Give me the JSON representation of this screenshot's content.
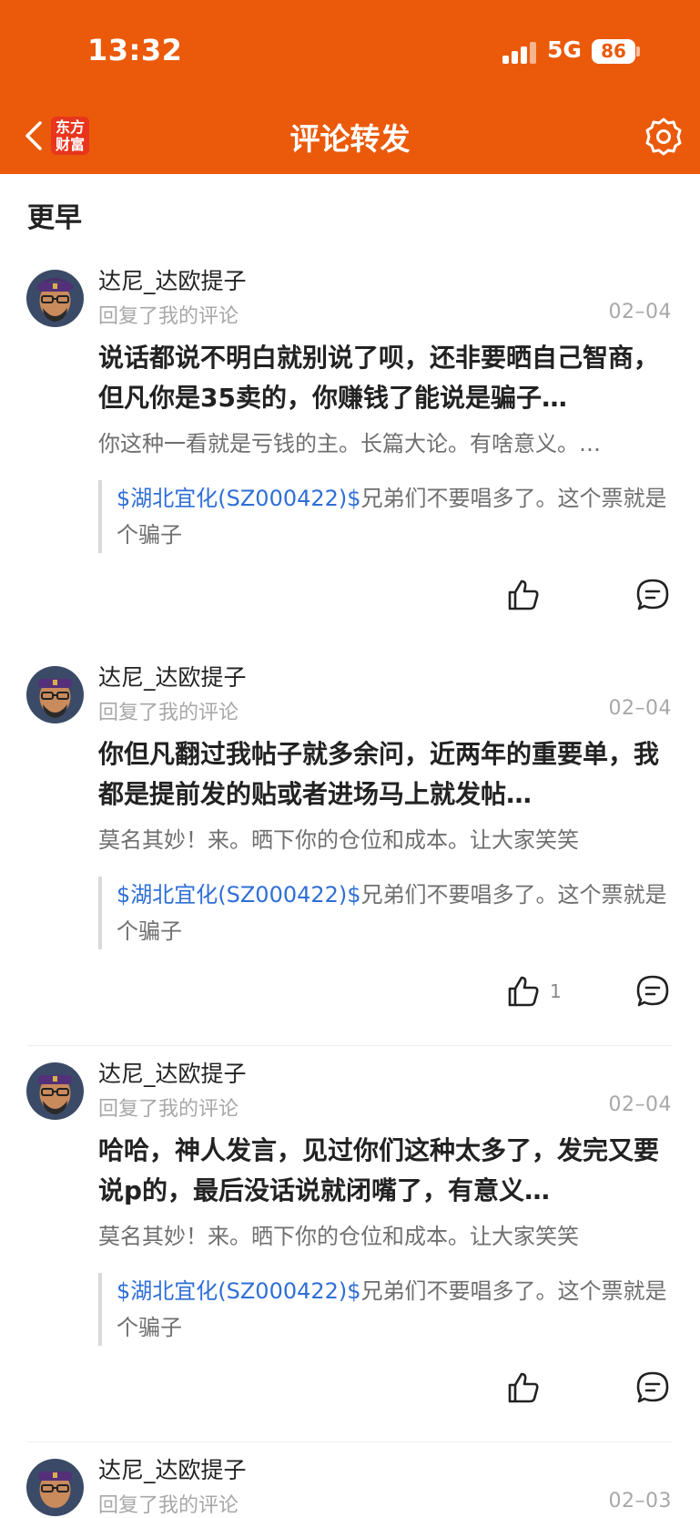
{
  "status_bar": {
    "time": "13:32",
    "network": "5G",
    "battery": "86"
  },
  "header": {
    "title": "评论转发",
    "logo_line1": "东方",
    "logo_line2": "财富"
  },
  "section": {
    "title": "更早"
  },
  "colors": {
    "brand": "#ea5a0a",
    "link": "#2f6fd6"
  },
  "items": [
    {
      "author": "达尼_达欧提子",
      "subtitle": "回复了我的评论",
      "date": "02–04",
      "text": "说话都说不明白就别说了呗，还非要晒自己智商，但凡你是35卖的，你赚钱了能说是骗子…",
      "reply": "你这种一看就是亏钱的主。长篇大论。有啥意义。…",
      "quote_stock": "$湖北宜化(SZ000422)$",
      "quote_text": "兄弟们不要唱多了。这个票就是个骗子",
      "likes": ""
    },
    {
      "author": "达尼_达欧提子",
      "subtitle": "回复了我的评论",
      "date": "02–04",
      "text": "你但凡翻过我帖子就多余问，近两年的重要单，我都是提前发的贴或者进场马上就发帖…",
      "reply": "莫名其妙！来。晒下你的仓位和成本。让大家笑笑",
      "quote_stock": "$湖北宜化(SZ000422)$",
      "quote_text": "兄弟们不要唱多了。这个票就是个骗子",
      "likes": "1"
    },
    {
      "author": "达尼_达欧提子",
      "subtitle": "回复了我的评论",
      "date": "02–04",
      "text": "哈哈，神人发言，见过你们这种太多了，发完又要说p的，最后没话说就闭嘴了，有意义…",
      "reply": "莫名其妙！来。晒下你的仓位和成本。让大家笑笑",
      "quote_stock": "$湖北宜化(SZ000422)$",
      "quote_text": "兄弟们不要唱多了。这个票就是个骗子",
      "likes": ""
    },
    {
      "author": "达尼_达欧提子",
      "subtitle": "回复了我的评论",
      "date": "02–03"
    }
  ]
}
